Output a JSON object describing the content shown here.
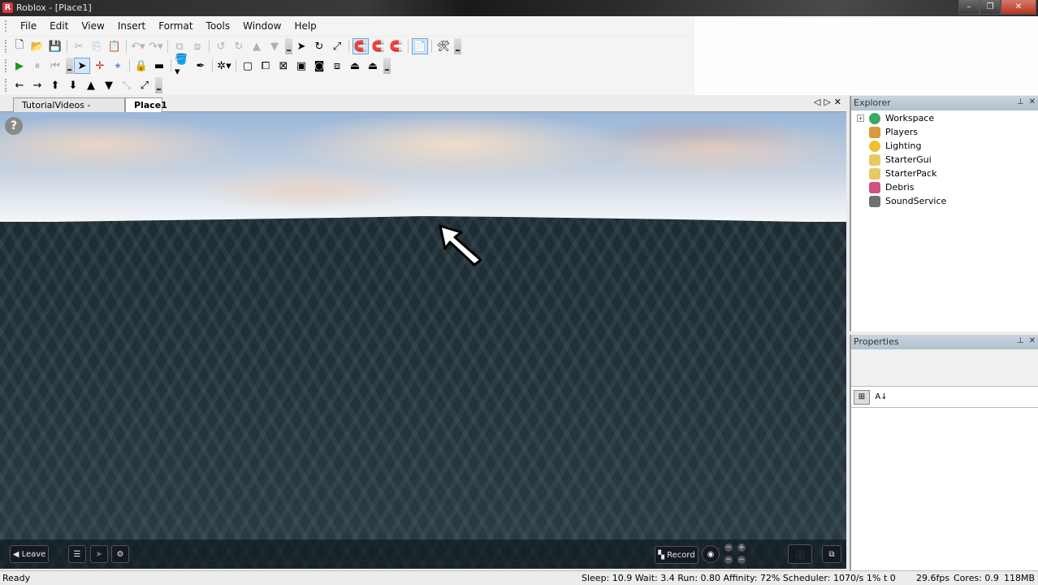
{
  "window": {
    "title": "Roblox - [Place1]",
    "app_icon": "roblox-logo",
    "controls": {
      "minimize": "–",
      "maximize": "❐",
      "close": "✕"
    }
  },
  "menu": [
    "File",
    "Edit",
    "View",
    "Insert",
    "Format",
    "Tools",
    "Window",
    "Help"
  ],
  "toolbars": {
    "row1": [
      {
        "name": "new-icon",
        "glyph": "🗋",
        "enabled": true
      },
      {
        "name": "open-icon",
        "glyph": "📂",
        "enabled": true
      },
      {
        "name": "save-icon",
        "glyph": "💾",
        "enabled": true
      },
      {
        "sep": true
      },
      {
        "name": "cut-icon",
        "glyph": "✂",
        "enabled": false
      },
      {
        "name": "copy-icon",
        "glyph": "⎘",
        "enabled": false
      },
      {
        "name": "paste-icon",
        "glyph": "📋",
        "enabled": false
      },
      {
        "sep": true
      },
      {
        "name": "undo-icon",
        "glyph": "↶▾",
        "enabled": false
      },
      {
        "name": "redo-icon",
        "glyph": "↷▾",
        "enabled": false
      },
      {
        "sep": true
      },
      {
        "name": "group-icon",
        "glyph": "⧉",
        "enabled": false
      },
      {
        "name": "ungroup-icon",
        "glyph": "⧈",
        "enabled": false
      },
      {
        "sep": true
      },
      {
        "name": "rotate-left-icon",
        "glyph": "↺",
        "enabled": false
      },
      {
        "name": "rotate-right-icon",
        "glyph": "↻",
        "enabled": false
      },
      {
        "name": "move-up-icon",
        "glyph": "▲",
        "enabled": false
      },
      {
        "name": "move-down-icon",
        "glyph": "▼",
        "enabled": false
      },
      {
        "overflow": true
      },
      {
        "name": "select-icon",
        "glyph": "➤",
        "enabled": true
      },
      {
        "name": "rotate-tool-icon",
        "glyph": "↻",
        "enabled": true
      },
      {
        "name": "resize-tool-icon",
        "glyph": "⤢",
        "enabled": true
      },
      {
        "sep": true
      },
      {
        "name": "axis-snap-1-icon",
        "glyph": "🧲",
        "enabled": true,
        "active": true
      },
      {
        "name": "axis-snap-half-icon",
        "glyph": "🧲",
        "enabled": true
      },
      {
        "name": "axis-snap-off-icon",
        "glyph": "🧲",
        "enabled": true
      },
      {
        "sep": true
      },
      {
        "name": "script-icon",
        "glyph": "📄",
        "enabled": true,
        "active": true
      },
      {
        "sep": true
      },
      {
        "name": "tools-icon",
        "glyph": "🛠",
        "enabled": true
      },
      {
        "overflow": true
      }
    ],
    "row2": [
      {
        "name": "play-icon",
        "glyph": "▶",
        "enabled": true,
        "color": "#1a9a1a"
      },
      {
        "name": "pause-icon",
        "glyph": "⏸",
        "enabled": false
      },
      {
        "name": "reset-icon",
        "glyph": "⏮",
        "enabled": false
      },
      {
        "overflow": true
      },
      {
        "name": "pointer-tool-icon",
        "glyph": "➤",
        "enabled": true,
        "active": true
      },
      {
        "name": "move-tool-icon",
        "glyph": "✛",
        "enabled": true,
        "color": "#d02020"
      },
      {
        "name": "move-drag-icon",
        "glyph": "⌖",
        "enabled": true,
        "color": "#2050c0"
      },
      {
        "sep": true
      },
      {
        "name": "lock-icon",
        "glyph": "🔒",
        "enabled": true
      },
      {
        "name": "anchor-icon",
        "glyph": "▬",
        "enabled": true
      },
      {
        "sep": true
      },
      {
        "name": "paint-bucket-icon",
        "glyph": "🪣▾",
        "enabled": true
      },
      {
        "name": "dropper-icon",
        "glyph": "✒",
        "enabled": true
      },
      {
        "sep": true
      },
      {
        "name": "surface-icon",
        "glyph": "✲▾",
        "enabled": true
      },
      {
        "sep": true
      },
      {
        "name": "smooth-surface-icon",
        "glyph": "▢",
        "enabled": true
      },
      {
        "name": "glue-surface-icon",
        "glyph": "⧠",
        "enabled": true
      },
      {
        "name": "weld-surface-icon",
        "glyph": "⊠",
        "enabled": true
      },
      {
        "name": "studs-surface-icon",
        "glyph": "▣",
        "enabled": true
      },
      {
        "name": "inlet-surface-icon",
        "glyph": "◙",
        "enabled": true
      },
      {
        "name": "universal-surface-icon",
        "glyph": "⧈",
        "enabled": true
      },
      {
        "name": "hinge-surface-icon",
        "glyph": "⏏",
        "enabled": true
      },
      {
        "name": "motor-surface-icon",
        "glyph": "⏏",
        "enabled": true
      },
      {
        "overflow": true
      }
    ],
    "row3": [
      {
        "name": "pan-left-icon",
        "glyph": "←",
        "enabled": true
      },
      {
        "name": "pan-right-icon",
        "glyph": "→",
        "enabled": true
      },
      {
        "name": "tilt-up-icon",
        "glyph": "⬆",
        "enabled": true
      },
      {
        "name": "tilt-down-icon",
        "glyph": "⬇",
        "enabled": true
      },
      {
        "name": "zoom-in-icon",
        "glyph": "▲",
        "enabled": true
      },
      {
        "name": "zoom-out-icon",
        "glyph": "▼",
        "enabled": true
      },
      {
        "name": "zoom-extents-icon",
        "glyph": "⤡",
        "enabled": false
      },
      {
        "name": "fit-view-icon",
        "glyph": "⤢",
        "enabled": true
      },
      {
        "overflow": true
      }
    ]
  },
  "doc_tabs": [
    {
      "label": "TutorialVideos - ROBLOX",
      "active": false
    },
    {
      "label": "Place1",
      "active": true
    }
  ],
  "doc_nav": {
    "prev": "◁",
    "next": "▷",
    "close": "✕"
  },
  "viewport": {
    "help": "?",
    "hud": {
      "leave": "Leave",
      "record": "Record",
      "zoom_in": "+",
      "zoom_out": "−"
    }
  },
  "explorer": {
    "title": "Explorer",
    "pin": "⊥",
    "close": "✕",
    "items": [
      {
        "label": "Workspace",
        "icon": "globe-icon",
        "color": "#3aa860",
        "expandable": true
      },
      {
        "label": "Players",
        "icon": "players-icon",
        "color": "#d89a3a",
        "expandable": false
      },
      {
        "label": "Lighting",
        "icon": "lightbulb-icon",
        "color": "#f0c030",
        "expandable": false
      },
      {
        "label": "StarterGui",
        "icon": "folder-gui-icon",
        "color": "#e8c860",
        "expandable": false
      },
      {
        "label": "StarterPack",
        "icon": "folder-pack-icon",
        "color": "#e8c860",
        "expandable": false
      },
      {
        "label": "Debris",
        "icon": "debris-icon",
        "color": "#d05080",
        "expandable": false
      },
      {
        "label": "SoundService",
        "icon": "speaker-icon",
        "color": "#707070",
        "expandable": false
      }
    ]
  },
  "properties": {
    "title": "Properties",
    "pin": "⊥",
    "close": "✕",
    "categorized": "⊞",
    "alphabetical": "A↓"
  },
  "status": {
    "left": "Ready",
    "stats": "Sleep: 10.9 Wait: 3.4 Run: 0.80 Affinity: 72% Scheduler: 1070/s 1%",
    "t": "t 0",
    "fps": "29.6fps",
    "cores": "Cores: 0.9",
    "memory": "118MB"
  }
}
